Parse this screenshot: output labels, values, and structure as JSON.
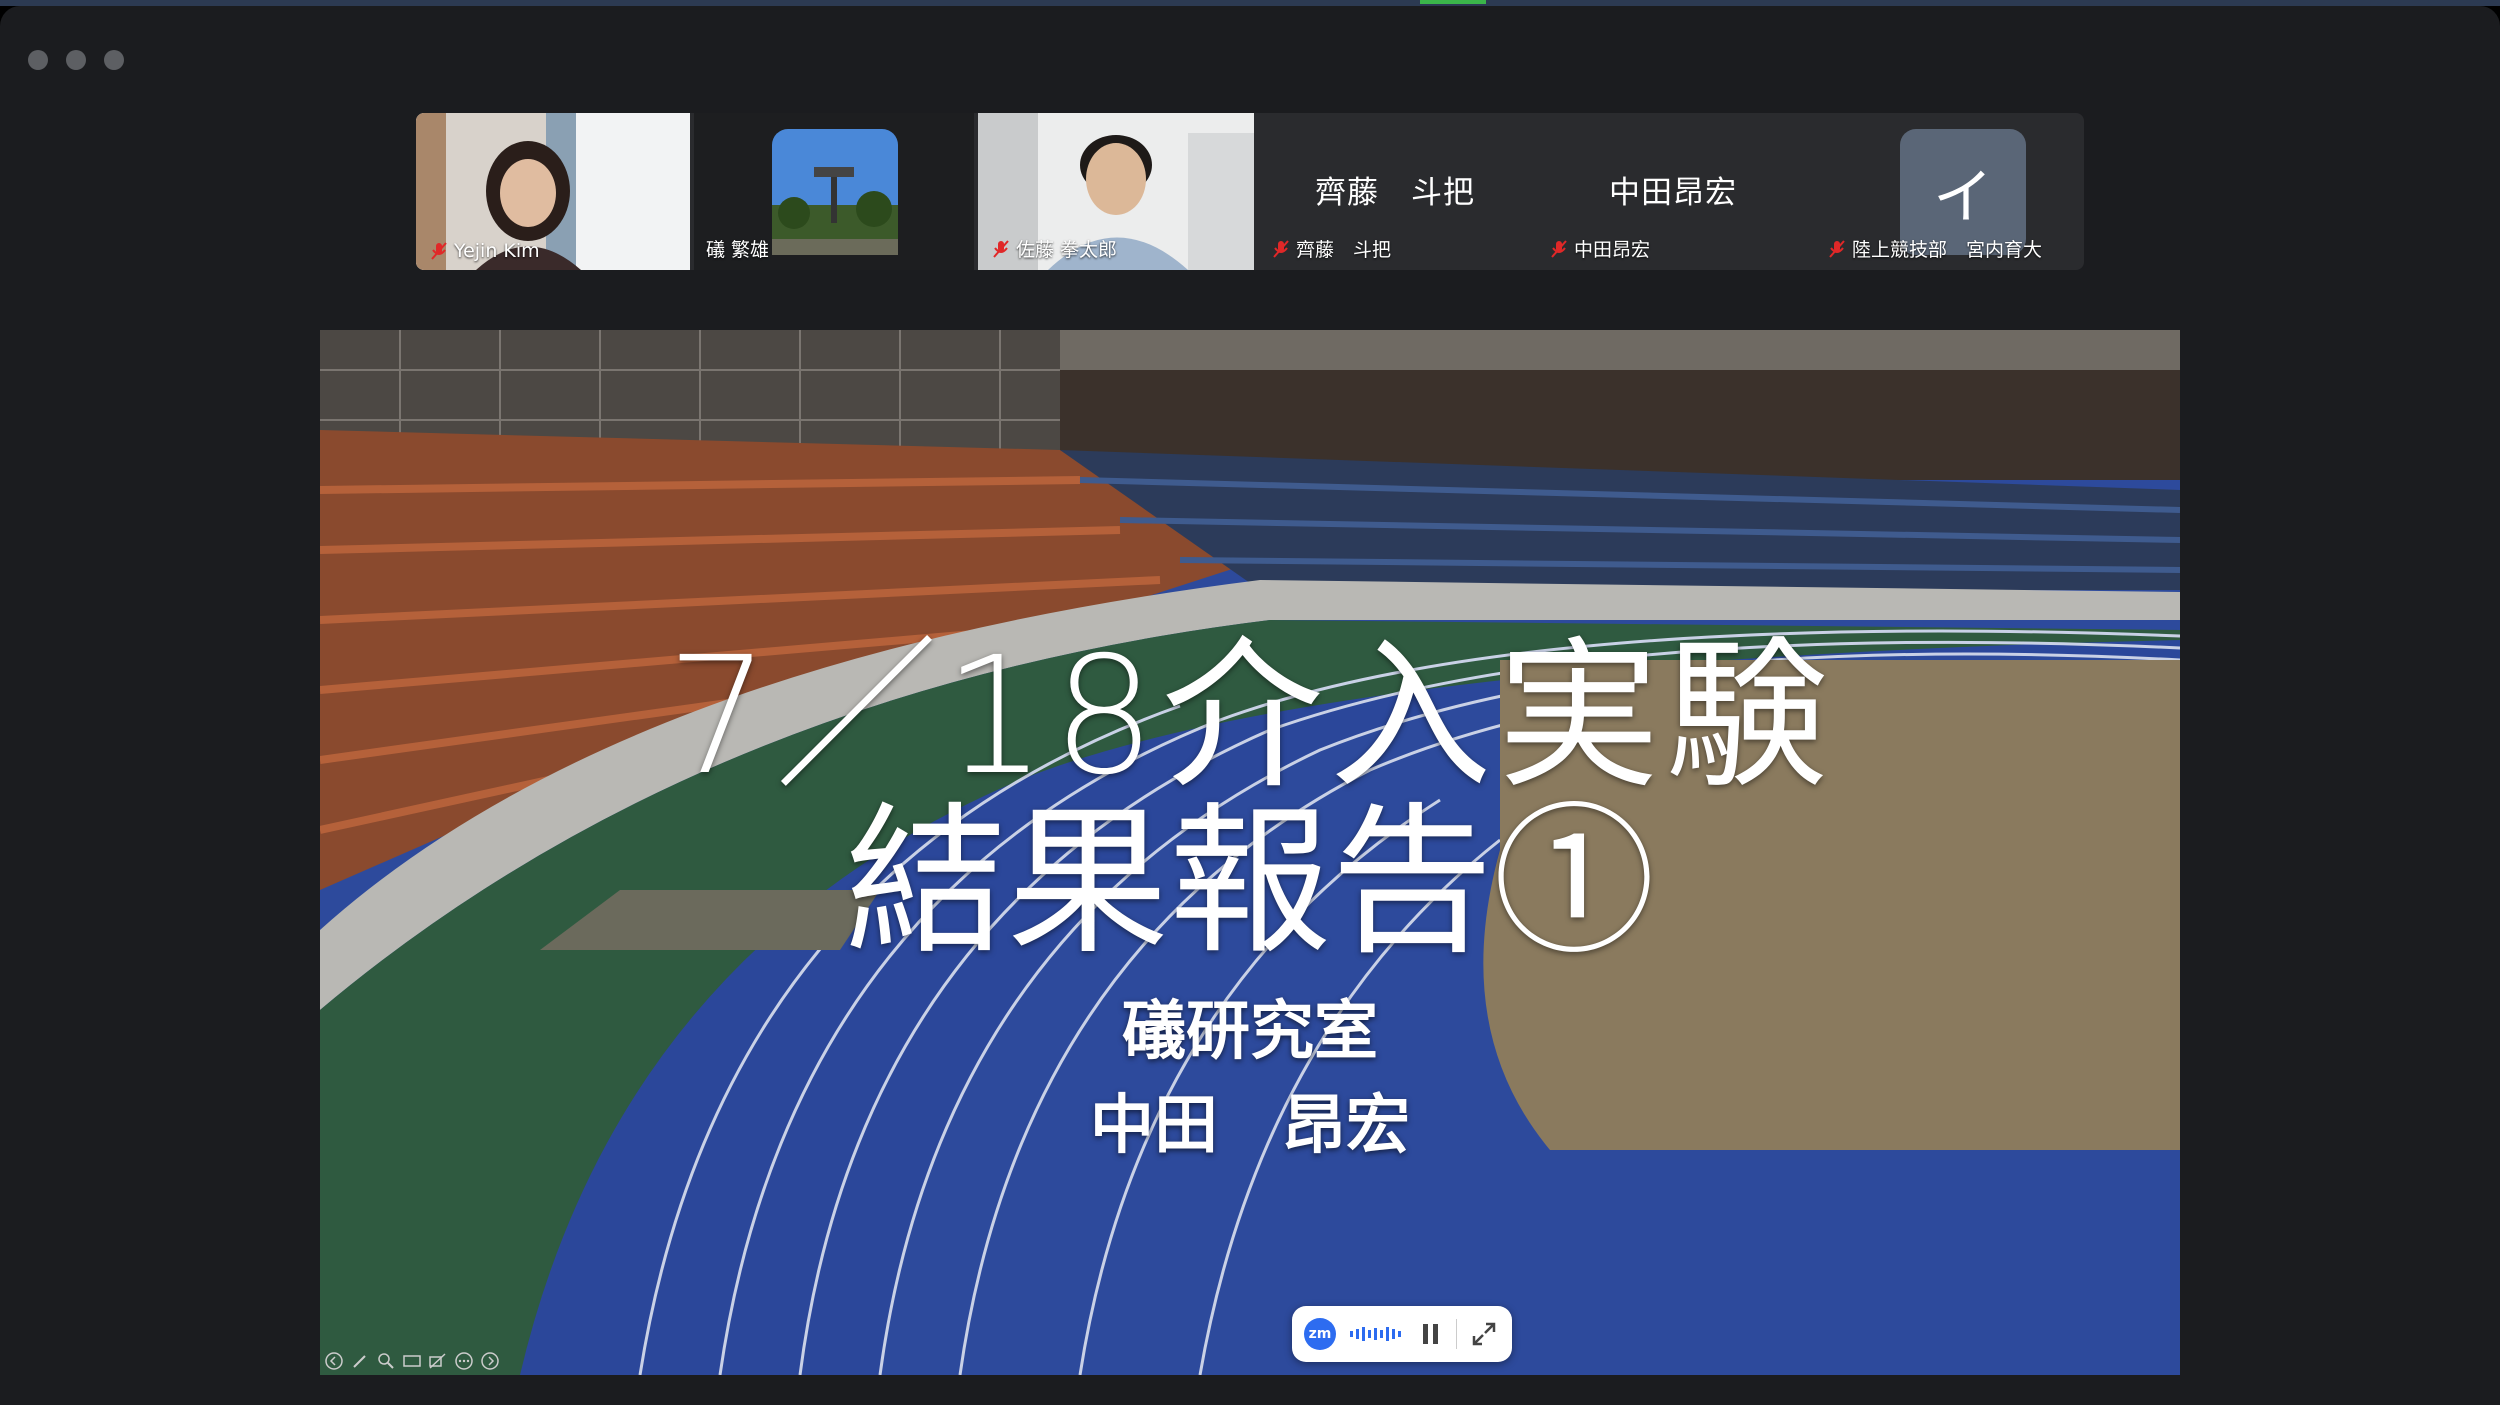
{
  "window": {
    "title_bar_buttons": [
      "close",
      "minimize",
      "zoom"
    ]
  },
  "gallery": {
    "participants": [
      {
        "name": "Yejin Kim",
        "type": "video",
        "muted": true
      },
      {
        "name": "礒 繁雄",
        "type": "video",
        "muted": false,
        "active_speaker": true
      },
      {
        "name": "佐藤 拳太郎",
        "type": "video",
        "muted": true
      },
      {
        "display": "齊藤　斗把",
        "name": "齊藤　斗把",
        "type": "name-only",
        "muted": true
      },
      {
        "display": "中田昂宏",
        "name": "中田昂宏",
        "type": "name-only",
        "muted": true
      },
      {
        "display": "イ",
        "name": "陸上競技部　宮内育大",
        "type": "avatar",
        "muted": true
      }
    ]
  },
  "slide": {
    "title_line1": "7／18介入実験",
    "title_line2": "結果報告①",
    "lab": "礒研究室",
    "presenter": "中田　昂宏"
  },
  "recording_pill": {
    "logo": "zm",
    "state": "recording",
    "pause_icon": "pause-icon",
    "expand_icon": "expand-icon"
  },
  "colors": {
    "active_speaker": "#3bd152",
    "muted_red": "#e02828",
    "zoom_blue": "#2d6cf0",
    "track_blue": "#2d4a9c"
  }
}
